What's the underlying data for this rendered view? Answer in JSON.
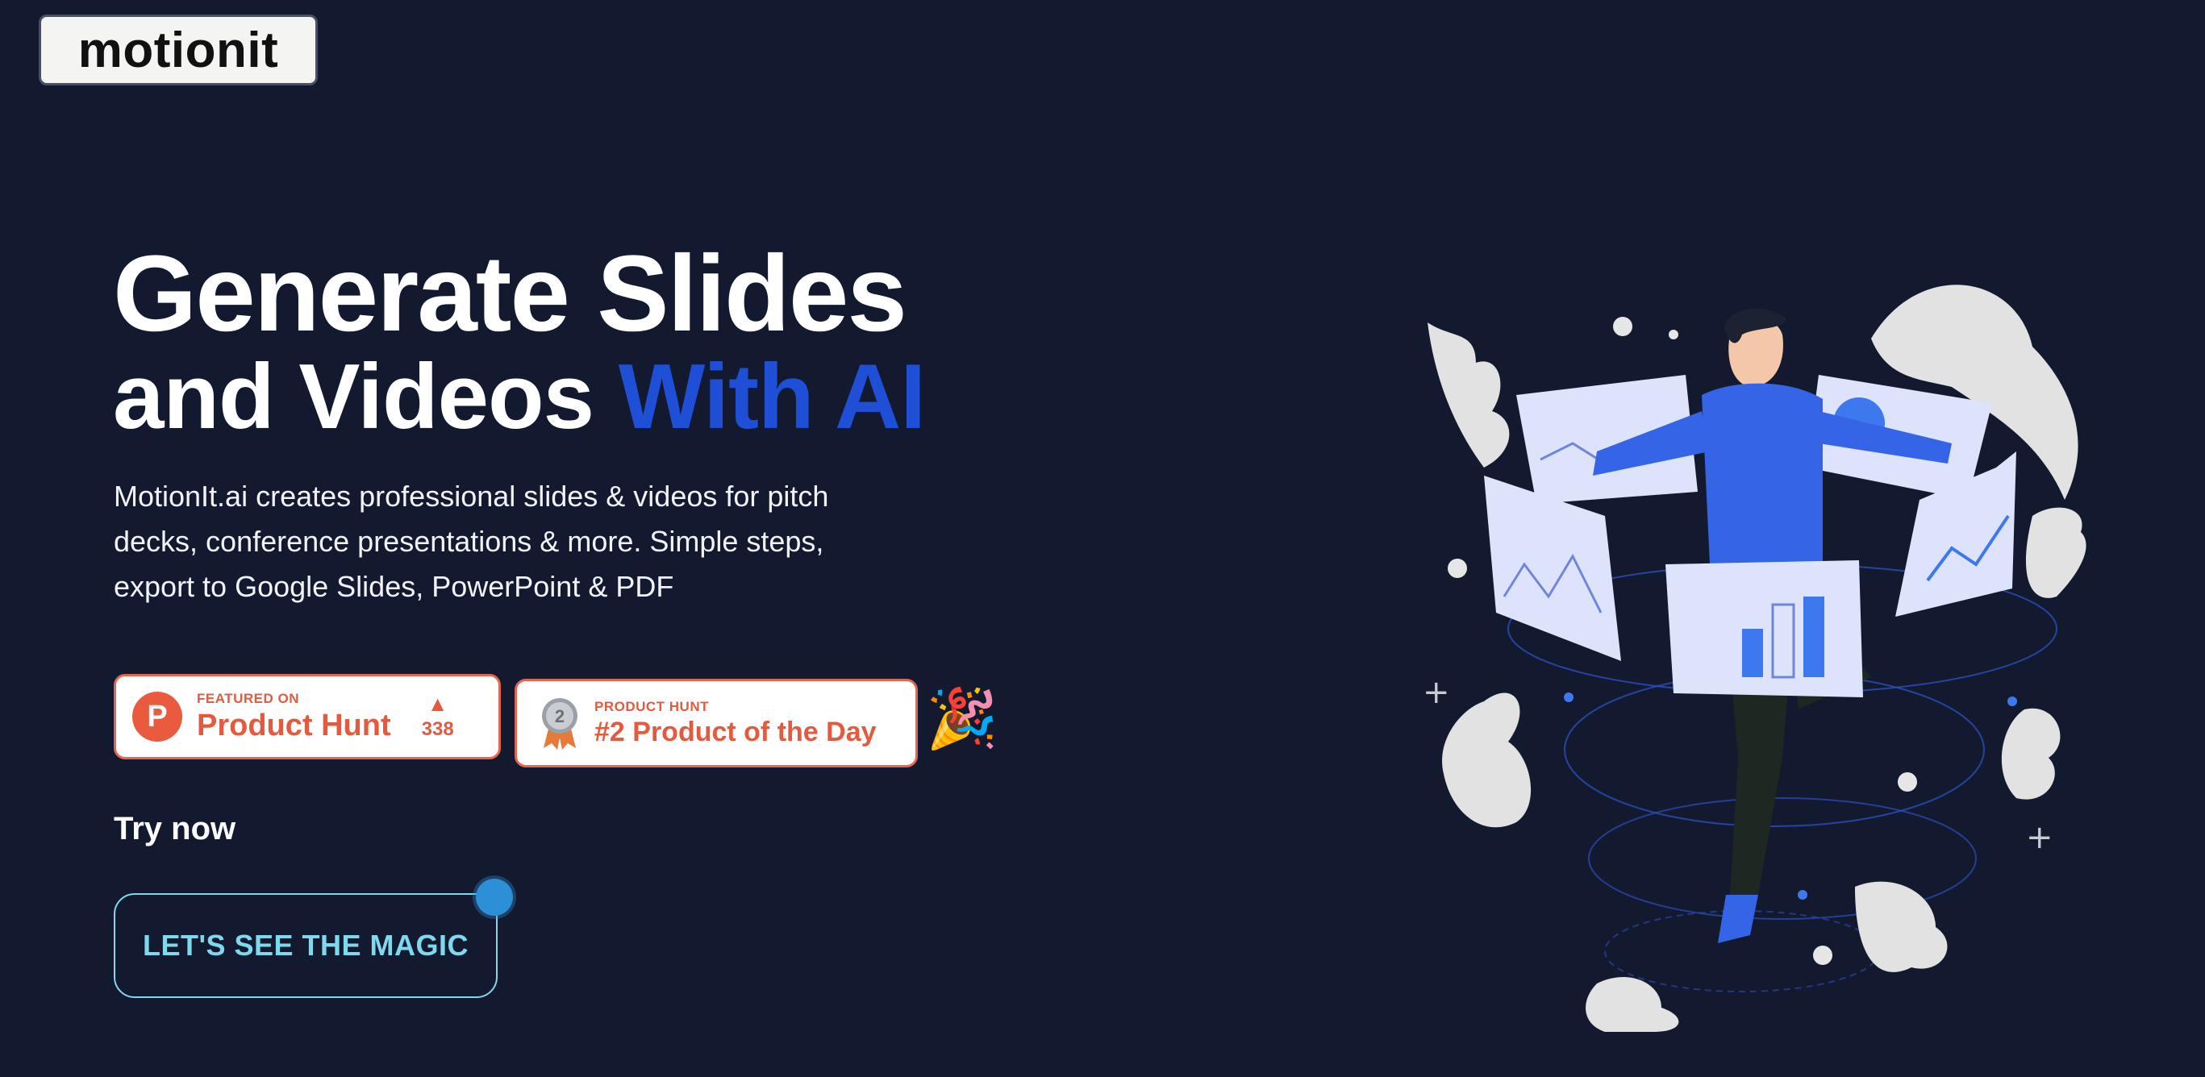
{
  "logo": {
    "text": "motionit"
  },
  "hero": {
    "headline_line1": "Generate Slides",
    "headline_line2_plain": "and Videos ",
    "headline_line2_accent": "With AI",
    "description": "MotionIt.ai creates professional slides & videos for pitch decks, conference presentations & more. Simple steps, export to Google Slides, PowerPoint & PDF"
  },
  "badges": {
    "product_hunt": {
      "eyebrow": "FEATURED ON",
      "title": "Product Hunt",
      "upvotes": "338",
      "icon": "product-hunt-logo"
    },
    "product_of_day": {
      "eyebrow": "PRODUCT HUNT",
      "title": "#2 Product of the Day",
      "medal_rank": "2",
      "icon": "silver-medal"
    },
    "celebration_icon": "party-popper"
  },
  "cta": {
    "try_now_label": "Try now",
    "button_label": "LET'S SEE THE MAGIC"
  },
  "colors": {
    "background": "#131a2f",
    "accent_blue": "#1f4fd6",
    "product_hunt_red": "#e35a3f",
    "cta_cyan": "#7fd9ee"
  }
}
